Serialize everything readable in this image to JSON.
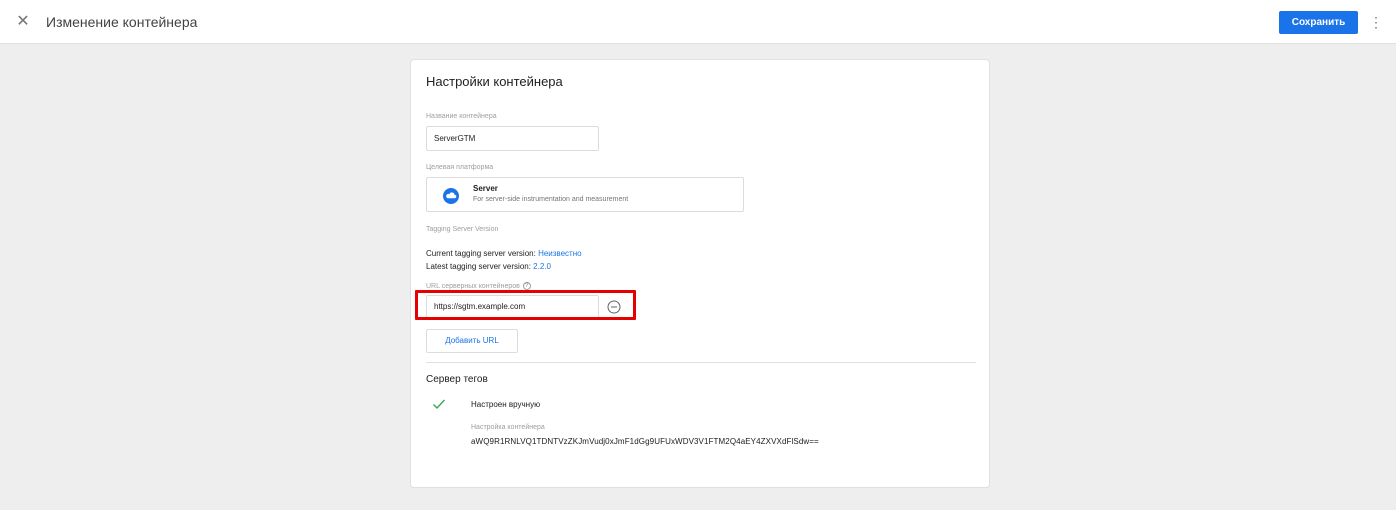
{
  "header": {
    "close_icon": "close-icon",
    "title": "Изменение контейнера",
    "save_label": "Сохранить",
    "more_icon": "more-vert-icon",
    "more_glyph": "⋮",
    "close_glyph": "✕"
  },
  "card": {
    "title": "Настройки контейнера",
    "container_name": {
      "label": "Название контейнера",
      "value": "ServerGTM"
    },
    "target_platform": {
      "label": "Целевая платформа",
      "icon": "cloud-icon",
      "name": "Server",
      "description": "For server-side instrumentation and measurement"
    },
    "tagging_server": {
      "label": "Tagging Server Version",
      "current_prefix": "Current tagging server version: ",
      "current_value": "Неизвестно",
      "latest_prefix": "Latest tagging server version: ",
      "latest_value": "2.2.0"
    },
    "server_urls": {
      "label": "URL серверных контейнеров",
      "help_icon": "help-icon",
      "help_glyph": "?",
      "url_value": "https://sgtm.example.com",
      "remove_icon": "remove-circle-icon",
      "add_label": "Добавить URL"
    },
    "tag_server": {
      "title": "Сервер тегов",
      "status_icon": "check-icon",
      "status": "Настроен вручную",
      "config_label": "Настройка контейнера",
      "config_value": "aWQ9R1RNLVQ1TDNTVzZKJmVudj0xJmF1dGg9UFUxWDV3V1FTM2Q4aEY4ZXVXdFlSdw=="
    }
  },
  "colors": {
    "accent": "#1a73e8",
    "highlight": "#e60000",
    "check": "#34a853"
  }
}
